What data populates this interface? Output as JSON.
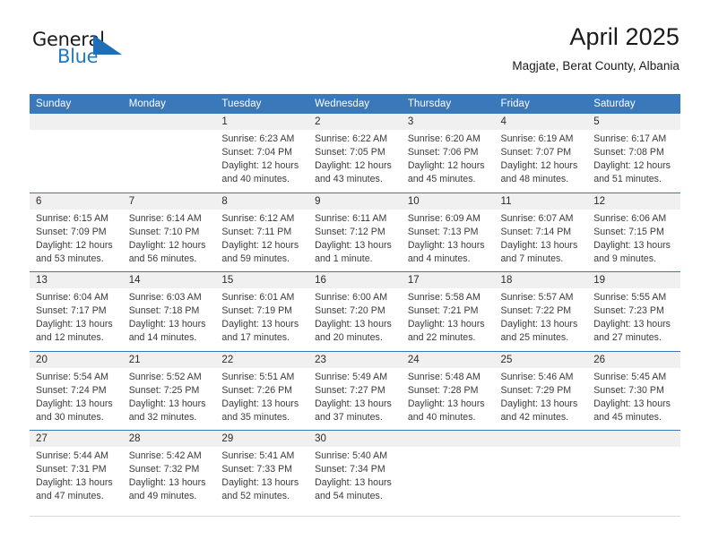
{
  "brand": {
    "name_part1": "General",
    "name_part2": "Blue",
    "triangle_icon": "triangle-icon",
    "accent_color": "#1f6fb8"
  },
  "header": {
    "title": "April 2025",
    "location": "Magjate, Berat County, Albania"
  },
  "calendar": {
    "header_color": "#3a78bc",
    "daynum_band_color": "#f0f0f0",
    "weekdays": [
      "Sunday",
      "Monday",
      "Tuesday",
      "Wednesday",
      "Thursday",
      "Friday",
      "Saturday"
    ],
    "weeks": [
      [
        {
          "day": "",
          "sunrise": "",
          "sunset": "",
          "daylight1": "",
          "daylight2": ""
        },
        {
          "day": "",
          "sunrise": "",
          "sunset": "",
          "daylight1": "",
          "daylight2": ""
        },
        {
          "day": "1",
          "sunrise": "Sunrise: 6:23 AM",
          "sunset": "Sunset: 7:04 PM",
          "daylight1": "Daylight: 12 hours",
          "daylight2": "and 40 minutes."
        },
        {
          "day": "2",
          "sunrise": "Sunrise: 6:22 AM",
          "sunset": "Sunset: 7:05 PM",
          "daylight1": "Daylight: 12 hours",
          "daylight2": "and 43 minutes."
        },
        {
          "day": "3",
          "sunrise": "Sunrise: 6:20 AM",
          "sunset": "Sunset: 7:06 PM",
          "daylight1": "Daylight: 12 hours",
          "daylight2": "and 45 minutes."
        },
        {
          "day": "4",
          "sunrise": "Sunrise: 6:19 AM",
          "sunset": "Sunset: 7:07 PM",
          "daylight1": "Daylight: 12 hours",
          "daylight2": "and 48 minutes."
        },
        {
          "day": "5",
          "sunrise": "Sunrise: 6:17 AM",
          "sunset": "Sunset: 7:08 PM",
          "daylight1": "Daylight: 12 hours",
          "daylight2": "and 51 minutes."
        }
      ],
      [
        {
          "day": "6",
          "sunrise": "Sunrise: 6:15 AM",
          "sunset": "Sunset: 7:09 PM",
          "daylight1": "Daylight: 12 hours",
          "daylight2": "and 53 minutes."
        },
        {
          "day": "7",
          "sunrise": "Sunrise: 6:14 AM",
          "sunset": "Sunset: 7:10 PM",
          "daylight1": "Daylight: 12 hours",
          "daylight2": "and 56 minutes."
        },
        {
          "day": "8",
          "sunrise": "Sunrise: 6:12 AM",
          "sunset": "Sunset: 7:11 PM",
          "daylight1": "Daylight: 12 hours",
          "daylight2": "and 59 minutes."
        },
        {
          "day": "9",
          "sunrise": "Sunrise: 6:11 AM",
          "sunset": "Sunset: 7:12 PM",
          "daylight1": "Daylight: 13 hours",
          "daylight2": "and 1 minute."
        },
        {
          "day": "10",
          "sunrise": "Sunrise: 6:09 AM",
          "sunset": "Sunset: 7:13 PM",
          "daylight1": "Daylight: 13 hours",
          "daylight2": "and 4 minutes."
        },
        {
          "day": "11",
          "sunrise": "Sunrise: 6:07 AM",
          "sunset": "Sunset: 7:14 PM",
          "daylight1": "Daylight: 13 hours",
          "daylight2": "and 7 minutes."
        },
        {
          "day": "12",
          "sunrise": "Sunrise: 6:06 AM",
          "sunset": "Sunset: 7:15 PM",
          "daylight1": "Daylight: 13 hours",
          "daylight2": "and 9 minutes."
        }
      ],
      [
        {
          "day": "13",
          "sunrise": "Sunrise: 6:04 AM",
          "sunset": "Sunset: 7:17 PM",
          "daylight1": "Daylight: 13 hours",
          "daylight2": "and 12 minutes."
        },
        {
          "day": "14",
          "sunrise": "Sunrise: 6:03 AM",
          "sunset": "Sunset: 7:18 PM",
          "daylight1": "Daylight: 13 hours",
          "daylight2": "and 14 minutes."
        },
        {
          "day": "15",
          "sunrise": "Sunrise: 6:01 AM",
          "sunset": "Sunset: 7:19 PM",
          "daylight1": "Daylight: 13 hours",
          "daylight2": "and 17 minutes."
        },
        {
          "day": "16",
          "sunrise": "Sunrise: 6:00 AM",
          "sunset": "Sunset: 7:20 PM",
          "daylight1": "Daylight: 13 hours",
          "daylight2": "and 20 minutes."
        },
        {
          "day": "17",
          "sunrise": "Sunrise: 5:58 AM",
          "sunset": "Sunset: 7:21 PM",
          "daylight1": "Daylight: 13 hours",
          "daylight2": "and 22 minutes."
        },
        {
          "day": "18",
          "sunrise": "Sunrise: 5:57 AM",
          "sunset": "Sunset: 7:22 PM",
          "daylight1": "Daylight: 13 hours",
          "daylight2": "and 25 minutes."
        },
        {
          "day": "19",
          "sunrise": "Sunrise: 5:55 AM",
          "sunset": "Sunset: 7:23 PM",
          "daylight1": "Daylight: 13 hours",
          "daylight2": "and 27 minutes."
        }
      ],
      [
        {
          "day": "20",
          "sunrise": "Sunrise: 5:54 AM",
          "sunset": "Sunset: 7:24 PM",
          "daylight1": "Daylight: 13 hours",
          "daylight2": "and 30 minutes."
        },
        {
          "day": "21",
          "sunrise": "Sunrise: 5:52 AM",
          "sunset": "Sunset: 7:25 PM",
          "daylight1": "Daylight: 13 hours",
          "daylight2": "and 32 minutes."
        },
        {
          "day": "22",
          "sunrise": "Sunrise: 5:51 AM",
          "sunset": "Sunset: 7:26 PM",
          "daylight1": "Daylight: 13 hours",
          "daylight2": "and 35 minutes."
        },
        {
          "day": "23",
          "sunrise": "Sunrise: 5:49 AM",
          "sunset": "Sunset: 7:27 PM",
          "daylight1": "Daylight: 13 hours",
          "daylight2": "and 37 minutes."
        },
        {
          "day": "24",
          "sunrise": "Sunrise: 5:48 AM",
          "sunset": "Sunset: 7:28 PM",
          "daylight1": "Daylight: 13 hours",
          "daylight2": "and 40 minutes."
        },
        {
          "day": "25",
          "sunrise": "Sunrise: 5:46 AM",
          "sunset": "Sunset: 7:29 PM",
          "daylight1": "Daylight: 13 hours",
          "daylight2": "and 42 minutes."
        },
        {
          "day": "26",
          "sunrise": "Sunrise: 5:45 AM",
          "sunset": "Sunset: 7:30 PM",
          "daylight1": "Daylight: 13 hours",
          "daylight2": "and 45 minutes."
        }
      ],
      [
        {
          "day": "27",
          "sunrise": "Sunrise: 5:44 AM",
          "sunset": "Sunset: 7:31 PM",
          "daylight1": "Daylight: 13 hours",
          "daylight2": "and 47 minutes."
        },
        {
          "day": "28",
          "sunrise": "Sunrise: 5:42 AM",
          "sunset": "Sunset: 7:32 PM",
          "daylight1": "Daylight: 13 hours",
          "daylight2": "and 49 minutes."
        },
        {
          "day": "29",
          "sunrise": "Sunrise: 5:41 AM",
          "sunset": "Sunset: 7:33 PM",
          "daylight1": "Daylight: 13 hours",
          "daylight2": "and 52 minutes."
        },
        {
          "day": "30",
          "sunrise": "Sunrise: 5:40 AM",
          "sunset": "Sunset: 7:34 PM",
          "daylight1": "Daylight: 13 hours",
          "daylight2": "and 54 minutes."
        },
        {
          "day": "",
          "sunrise": "",
          "sunset": "",
          "daylight1": "",
          "daylight2": ""
        },
        {
          "day": "",
          "sunrise": "",
          "sunset": "",
          "daylight1": "",
          "daylight2": ""
        },
        {
          "day": "",
          "sunrise": "",
          "sunset": "",
          "daylight1": "",
          "daylight2": ""
        }
      ]
    ]
  }
}
